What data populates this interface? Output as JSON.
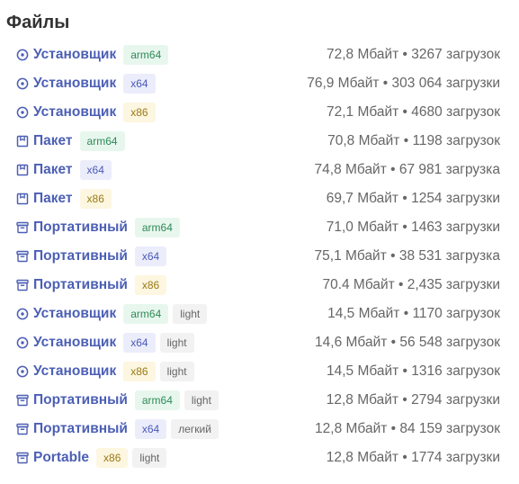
{
  "page": {
    "title": "Файлы"
  },
  "colors": {
    "link": "#4c5fb5",
    "arm64_bg": "#e8f7ee",
    "x64_bg": "#ecedfb",
    "x86_bg": "#fdf6e0",
    "light_bg": "#f2f2f2"
  },
  "files": [
    {
      "icon": "installer-icon",
      "name": "Установщик",
      "arch": "arm64",
      "variant": "",
      "meta": "72,8 Мбайт • 3267 загрузок"
    },
    {
      "icon": "installer-icon",
      "name": "Установщик",
      "arch": "x64",
      "variant": "",
      "meta": "76,9 Мбайт • 303 064 загрузки"
    },
    {
      "icon": "installer-icon",
      "name": "Установщик",
      "arch": "x86",
      "variant": "",
      "meta": "72,1 Мбайт • 4680 загрузок"
    },
    {
      "icon": "package-icon",
      "name": "Пакет",
      "arch": "arm64",
      "variant": "",
      "meta": "70,8 Мбайт • 1198 загрузок"
    },
    {
      "icon": "package-icon",
      "name": "Пакет",
      "arch": "x64",
      "variant": "",
      "meta": "74,8 Мбайт • 67 981 загрузка"
    },
    {
      "icon": "package-icon",
      "name": "Пакет",
      "arch": "x86",
      "variant": "",
      "meta": "69,7 Мбайт • 1254 загрузки"
    },
    {
      "icon": "archive-icon",
      "name": "Портативный",
      "arch": "arm64",
      "variant": "",
      "meta": "71,0 Мбайт • 1463 загрузки"
    },
    {
      "icon": "archive-icon",
      "name": "Портативный",
      "arch": "x64",
      "variant": "",
      "meta": "75,1 Мбайт • 38 531 загрузка"
    },
    {
      "icon": "archive-icon",
      "name": "Портативный",
      "arch": "x86",
      "variant": "",
      "meta": "70.4 Мбайт • 2,435 загрузки"
    },
    {
      "icon": "installer-icon",
      "name": "Установщик",
      "arch": "arm64",
      "variant": "light",
      "meta": "14,5 Мбайт • 1170 загрузок"
    },
    {
      "icon": "installer-icon",
      "name": "Установщик",
      "arch": "x64",
      "variant": "light",
      "meta": "14,6 Мбайт • 56 548 загрузок"
    },
    {
      "icon": "installer-icon",
      "name": "Установщик",
      "arch": "x86",
      "variant": "light",
      "meta": "14,5 Мбайт • 1316 загрузок"
    },
    {
      "icon": "archive-icon",
      "name": "Портативный",
      "arch": "arm64",
      "variant": "light",
      "meta": "12,8 Мбайт • 2794 загрузки"
    },
    {
      "icon": "archive-icon",
      "name": "Портативный",
      "arch": "x64",
      "variant": "легкий",
      "meta": "12,8 Мбайт • 84 159 загрузок"
    },
    {
      "icon": "archive-icon",
      "name": "Portable",
      "arch": "x86",
      "variant": "light",
      "meta": "12,8 Мбайт • 1774 загрузки"
    }
  ]
}
